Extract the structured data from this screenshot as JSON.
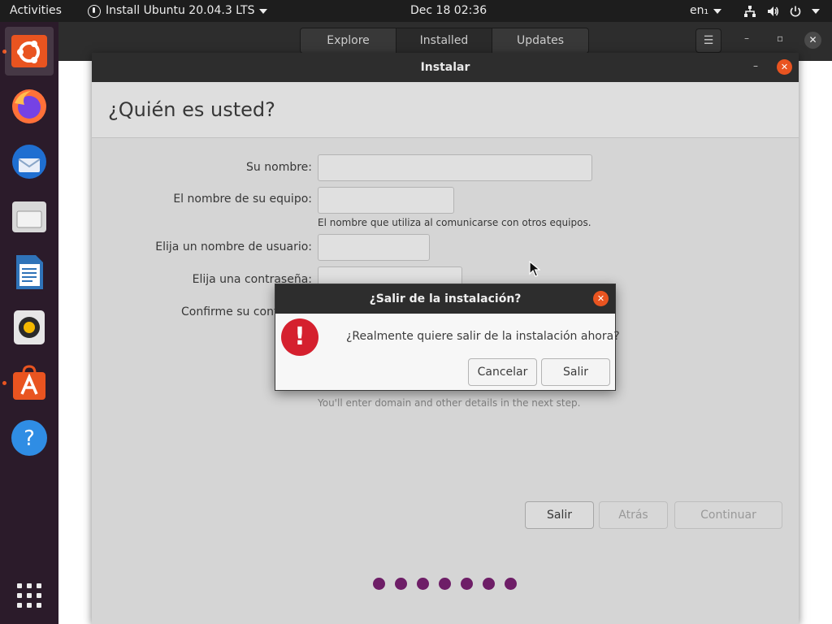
{
  "topbar": {
    "activities": "Activities",
    "app_menu": "Install Ubuntu 20.04.3 LTS",
    "clock": "Dec 18  02:36",
    "lang": "en₁"
  },
  "dock": {
    "items": [
      {
        "name": "ubuntu-installer",
        "running": true,
        "active": true
      },
      {
        "name": "firefox",
        "running": false
      },
      {
        "name": "thunderbird",
        "running": false
      },
      {
        "name": "files",
        "running": false
      },
      {
        "name": "libreoffice-writer",
        "running": false
      },
      {
        "name": "rhythmbox",
        "running": false
      },
      {
        "name": "ubuntu-software",
        "running": true
      },
      {
        "name": "help",
        "running": false
      }
    ],
    "show_apps_icon": "grid-icon"
  },
  "software_window": {
    "tabs": [
      {
        "label": "Explore",
        "selected": false
      },
      {
        "label": "Installed",
        "selected": true
      },
      {
        "label": "Updates",
        "selected": false
      }
    ],
    "menu_icon": "☰",
    "minimize": "–",
    "maximize": "▫",
    "close": "✕"
  },
  "installer": {
    "title": "Instalar",
    "minimize": "–",
    "close": "✕",
    "heading": "¿Quién es usted?",
    "fields": {
      "name_label": "Su nombre:",
      "name_value": "",
      "computer_label": "El nombre de su equipo:",
      "computer_value": "",
      "computer_hint": "El nombre que utiliza al comunicarse con otros equipos.",
      "username_label": "Elija un nombre de usuario:",
      "username_value": "",
      "password_label": "Elija una contraseña:",
      "password_value": "",
      "confirm_label": "Confirme su cont",
      "domain_hint": "You'll enter domain and other details in the next step."
    },
    "buttons": {
      "quit": "Salir",
      "back": "Atrás",
      "continue": "Continuar"
    },
    "progress_steps": 7
  },
  "dialog": {
    "title": "¿Salir de la instalación?",
    "close": "✕",
    "icon": "!",
    "message": "¿Realmente quiere salir de la instalación ahora?",
    "cancel": "Cancelar",
    "quit": "Salir"
  },
  "colors": {
    "accent": "#e95420",
    "progress": "#77216f",
    "error_icon": "#d5202e",
    "dock_bg": "#2b1b2a",
    "titlebar": "#2d2d2d"
  }
}
